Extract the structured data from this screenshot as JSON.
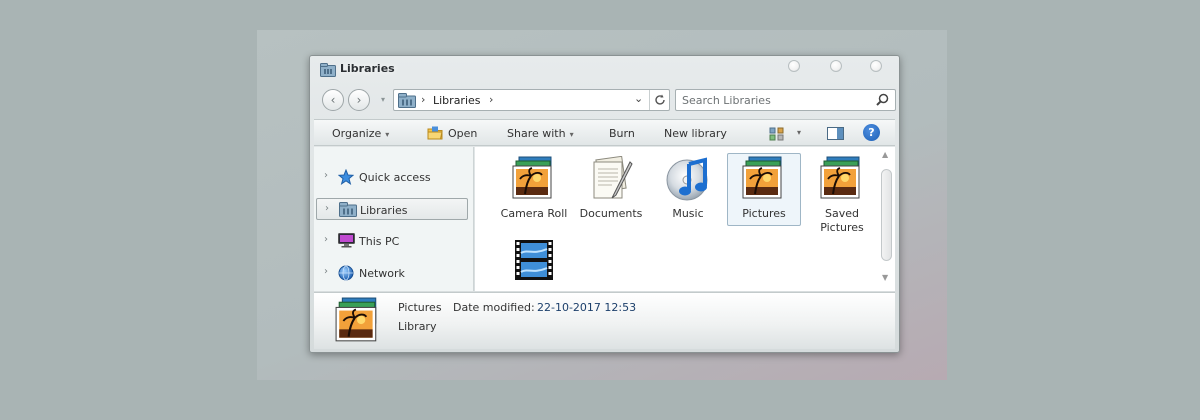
{
  "window": {
    "title": "Libraries"
  },
  "address_bar": {
    "crumbs": [
      "Libraries"
    ],
    "separator": "›"
  },
  "search": {
    "placeholder": "Search Libraries"
  },
  "toolbar": {
    "organize": "Organize",
    "open": "Open",
    "share_with": "Share with",
    "burn": "Burn",
    "new_library": "New library",
    "help": "?"
  },
  "navigation": {
    "items": [
      {
        "label": "Quick access",
        "icon": "star-icon"
      },
      {
        "label": "Libraries",
        "icon": "library-icon",
        "selected": true
      },
      {
        "label": "This PC",
        "icon": "computer-icon"
      },
      {
        "label": "Network",
        "icon": "network-icon"
      }
    ]
  },
  "files": [
    {
      "label": "Camera Roll",
      "icon": "pictures-library-icon"
    },
    {
      "label": "Documents",
      "icon": "documents-library-icon"
    },
    {
      "label": "Music",
      "icon": "music-library-icon"
    },
    {
      "label": "Pictures",
      "icon": "pictures-library-icon",
      "selected": true
    },
    {
      "label": "Saved Pictures",
      "icon": "pictures-library-icon"
    },
    {
      "label": "",
      "icon": "videos-library-icon"
    }
  ],
  "details": {
    "name": "Pictures",
    "modified_label": "Date modified:",
    "modified_value": "22-10-2017 12:53",
    "type": "Library"
  },
  "colors": {
    "accent": "#1c5fb5",
    "selection": "#eef5fa"
  }
}
